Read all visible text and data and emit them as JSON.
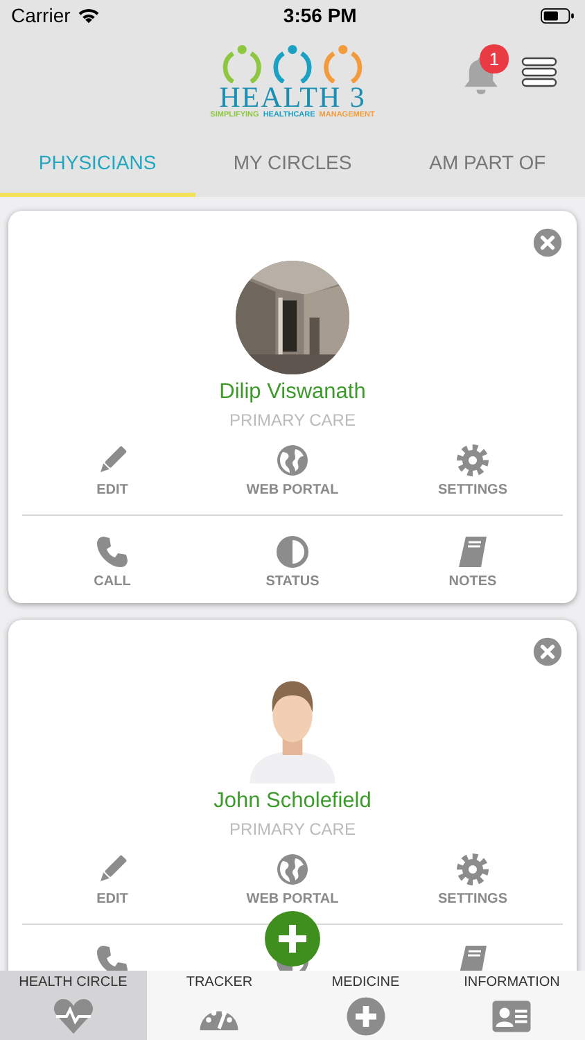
{
  "status_bar": {
    "carrier": "Carrier",
    "time": "3:56 PM"
  },
  "header": {
    "logo": {
      "title": "HEALTH 3",
      "tagline": [
        {
          "text": "SIMPLIFYING",
          "color": "#8dc63f"
        },
        {
          "text": "HEALTHCARE",
          "color": "#1ba1c4"
        },
        {
          "text": "MANAGEMENT",
          "color": "#f39a3a"
        }
      ]
    },
    "notifications": {
      "count": "1"
    }
  },
  "tabs": [
    {
      "label": "PHYSICIANS",
      "selected": true
    },
    {
      "label": "MY CIRCLES",
      "selected": false
    },
    {
      "label": "AM PART OF",
      "selected": false
    }
  ],
  "physicians": [
    {
      "name": "Dilip Viswanath",
      "specialty": "PRIMARY CARE",
      "avatar": {
        "kind": "picture"
      },
      "actions": [
        {
          "kind": "edit",
          "label": "EDIT"
        },
        {
          "kind": "globe",
          "label": "WEB PORTAL"
        },
        {
          "kind": "gear",
          "label": "SETTINGS"
        }
      ],
      "more_actions": [
        {
          "kind": "phone",
          "label": "CALL"
        },
        {
          "kind": "status",
          "label": "STATUS"
        },
        {
          "kind": "book",
          "label": "NOTES"
        }
      ]
    },
    {
      "name": "John Scholefield",
      "specialty": "PRIMARY CARE",
      "avatar": {
        "kind": "silhouette"
      },
      "actions": [
        {
          "kind": "edit",
          "label": "EDIT"
        },
        {
          "kind": "globe",
          "label": "WEB PORTAL"
        },
        {
          "kind": "gear",
          "label": "SETTINGS"
        }
      ],
      "more_actions": [
        {
          "kind": "phone"
        },
        {
          "kind": "status"
        },
        {
          "kind": "book"
        }
      ]
    }
  ],
  "bottom_tabs": [
    {
      "label": "HEALTH CIRCLE",
      "kind": "heart",
      "selected": true
    },
    {
      "label": "TRACKER",
      "kind": "gauge",
      "selected": false
    },
    {
      "label": "MEDICINE",
      "kind": "plus",
      "selected": false
    },
    {
      "label": "INFORMATION",
      "kind": "card",
      "selected": false
    }
  ]
}
